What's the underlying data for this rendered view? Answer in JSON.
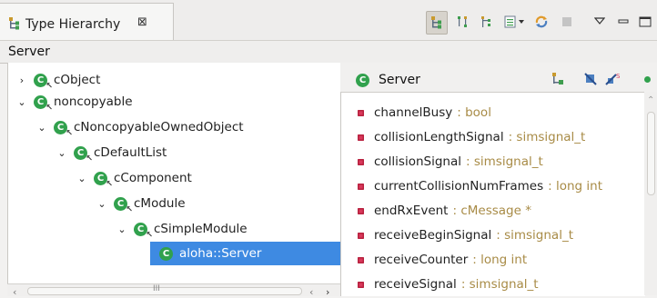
{
  "view": {
    "tab_title": "Type Hierarchy",
    "tab_close_glyph": "⊠",
    "subtitle": "Server",
    "toolbar_icons": [
      "hierarchy-view-icon",
      "supertype-view-icon",
      "subtype-view-icon",
      "history-dropdown-icon",
      "refresh-icon",
      "stop-icon",
      "view-menu-icon",
      "minimize-icon",
      "maximize-icon"
    ]
  },
  "tree": {
    "nodes": [
      {
        "label": "cObject",
        "expanded": false,
        "depth": 0
      },
      {
        "label": "noncopyable",
        "expanded": true,
        "depth": 0
      },
      {
        "label": "cNoncopyableOwnedObject",
        "expanded": true,
        "depth": 1
      },
      {
        "label": "cDefaultList",
        "expanded": true,
        "depth": 2
      },
      {
        "label": "cComponent",
        "expanded": true,
        "depth": 3
      },
      {
        "label": "cModule",
        "expanded": true,
        "depth": 4
      },
      {
        "label": "cSimpleModule",
        "expanded": true,
        "depth": 5
      },
      {
        "label": "aloha::Server",
        "selected": true,
        "depth": 6
      }
    ],
    "scroll_indicator": "III"
  },
  "members_panel": {
    "title": "Server",
    "class_icon_glyph": "C",
    "members": [
      {
        "name": "channelBusy",
        "type": ": bool"
      },
      {
        "name": "collisionLengthSignal",
        "type": ": simsignal_t"
      },
      {
        "name": "collisionSignal",
        "type": ": simsignal_t"
      },
      {
        "name": "currentCollisionNumFrames",
        "type": ": long int"
      },
      {
        "name": "endRxEvent",
        "type": ": cMessage *"
      },
      {
        "name": "receiveBeginSignal",
        "type": ": simsignal_t"
      },
      {
        "name": "receiveCounter",
        "type": ": long int"
      },
      {
        "name": "receiveSignal",
        "type": ": simsignal_t"
      }
    ]
  },
  "colors": {
    "class_icon_green": "#31a14d",
    "selection_blue": "#3e8ae2",
    "field_icon_red": "#d9385b",
    "type_text": "#a88b46"
  }
}
